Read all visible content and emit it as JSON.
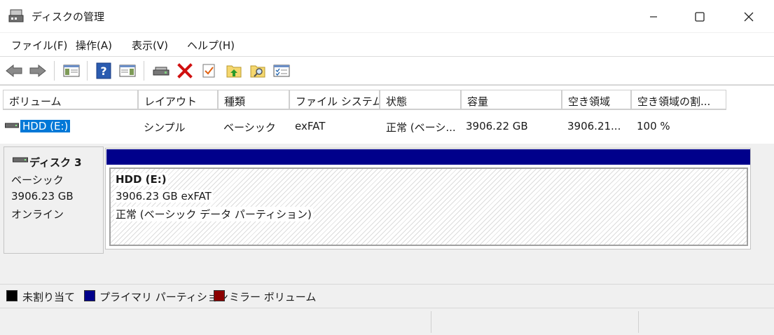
{
  "window": {
    "title": "ディスクの管理"
  },
  "menu": [
    "ファイル(F)",
    "操作(A)",
    "表示(V)",
    "ヘルプ(H)"
  ],
  "toolbar_icons": [
    "back-arrow-icon",
    "forward-arrow-icon",
    "show-pane-icon",
    "help-icon",
    "show-pane-2-icon",
    "connect-drive-icon",
    "delete-icon",
    "check-icon",
    "up-folder-icon",
    "search-folder-icon",
    "properties-icon"
  ],
  "columns": [
    "ボリューム",
    "レイアウト",
    "種類",
    "ファイル システム",
    "状態",
    "容量",
    "空き領域",
    "空き領域の割..."
  ],
  "volumes": [
    {
      "name": "HDD (E:)",
      "layout": "シンプル",
      "type": "ベーシック",
      "fs": "exFAT",
      "status": "正常 (ベーシ...",
      "capacity": "3906.22 GB",
      "free": "3906.21...",
      "free_pct": "100 %"
    }
  ],
  "disk": {
    "name": "ディスク 3",
    "type": "ベーシック",
    "size": "3906.23 GB",
    "state": "オンライン",
    "partition": {
      "name": "HDD  (E:)",
      "detail": "3906.23 GB exFAT",
      "status": "正常 (ベーシック データ パーティション)"
    }
  },
  "legend": [
    {
      "label": "未割り当て",
      "color": "#000000"
    },
    {
      "label": "プライマリ パーティション",
      "color": "#00008b"
    },
    {
      "label": "ミラー ボリューム",
      "color": "#8b0000"
    }
  ]
}
